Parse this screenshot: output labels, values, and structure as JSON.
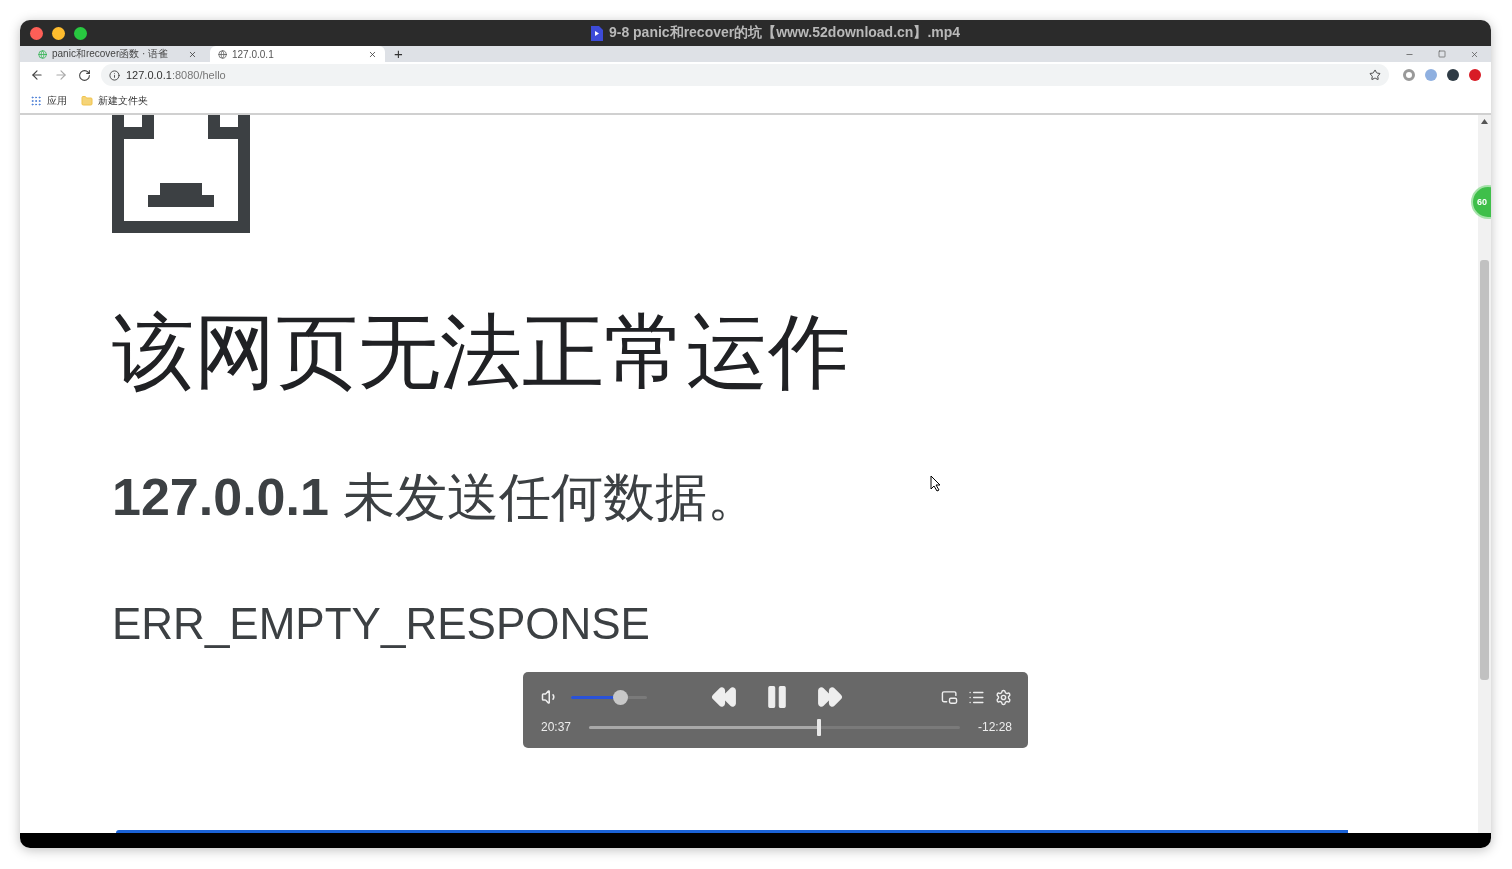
{
  "window": {
    "title": "9-8 panic和recover的坑【www.52download.cn】.mp4"
  },
  "browser": {
    "tabs": [
      {
        "label": "panic和recover函数 · 语雀",
        "selected": false
      },
      {
        "label": "127.0.0.1",
        "selected": true
      }
    ],
    "new_tab": "+",
    "address": {
      "host": "127.0.0.1",
      "path": ":8080/hello"
    },
    "bookmarks": [
      {
        "kind": "apps",
        "label": "应用"
      },
      {
        "kind": "folder",
        "label": "新建文件夹"
      }
    ]
  },
  "page": {
    "heading": "该网页无法正常运作",
    "message": "**127.0.0.1** 未发送任何数据。",
    "error_code": "ERR_EMPTY_RESPONSE"
  },
  "floating_badge": "60",
  "player": {
    "playing": true,
    "volume": {
      "level": 0.64
    },
    "elapsed": "20:37",
    "remaining": "-12:28",
    "position": {
      "level": 0.62
    }
  }
}
